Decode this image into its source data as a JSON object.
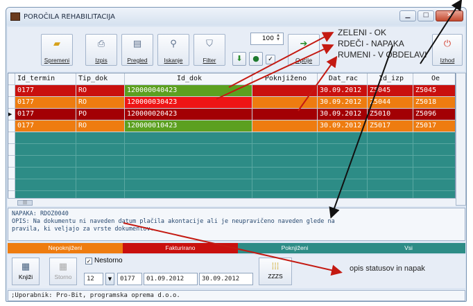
{
  "window": {
    "title": "POROČILA REHABILITACIJA",
    "min_label": "▁",
    "max_label": "□",
    "close_label": "✕"
  },
  "toolbar": {
    "buttons": [
      {
        "label": "Spremeni",
        "icon": "folder-icon"
      },
      {
        "label": "Izpis",
        "icon": "printer-icon"
      },
      {
        "label": "Pregled",
        "icon": "document-icon"
      },
      {
        "label": "Iskanje",
        "icon": "search-icon"
      },
      {
        "label": "Filter",
        "icon": "filter-icon"
      }
    ],
    "counter_value": "100",
    "opcije_label": "Opcije",
    "izhod_label": "Izhod"
  },
  "legend_lines": [
    "ZELENI - OK",
    "RDEČI - NAPAKA",
    "RUMENI - V OBDELAVI"
  ],
  "grid": {
    "columns": [
      "Id_termin",
      "Tip_dok",
      "Id_dok",
      "Poknjiženo",
      "Dat_rac",
      "Id_izp",
      "Oe"
    ],
    "rows": [
      {
        "cells": [
          "0177",
          "RO",
          "120000040423",
          "",
          "30.09.2012",
          "Z5045",
          "Z5045"
        ],
        "color": "red",
        "dok_color": "green",
        "selected": false
      },
      {
        "cells": [
          "0177",
          "RO",
          "120000030423",
          "",
          "30.09.2012",
          "Z5044",
          "Z5018"
        ],
        "color": "orange",
        "dok_color": "bright",
        "selected": false
      },
      {
        "cells": [
          "0177",
          "PO",
          "120000020423",
          "",
          "30.09.2012",
          "Z5010",
          "Z5096"
        ],
        "color": "dred",
        "dok_color": "dred",
        "selected": true
      },
      {
        "cells": [
          "0177",
          "RO",
          "120000010423",
          "",
          "30.09.2012",
          "Z5017",
          "Z5017"
        ],
        "color": "orange",
        "dok_color": "green",
        "selected": false
      }
    ],
    "empty_rows": 9
  },
  "message": {
    "line1": "NAPAKA: RDOZ0040",
    "line2": "OPIS: Na dokumentu ni naveden datum plačila akontacije ali je neupravičeno naveden glede na",
    "line3": "pravila, ki veljajo za vrste dokumentov."
  },
  "tabs": [
    {
      "label": "Nepoknjiženi",
      "color": "#ee7c10"
    },
    {
      "label": "Fakturirano",
      "color": "#c9100e"
    },
    {
      "label": "Poknjiženi",
      "color": "#2d8c86"
    },
    {
      "label": "Vsi",
      "color": "#2d8c86"
    }
  ],
  "bottom": {
    "knjizi_label": "Knjiži",
    "storno_label": "Storno",
    "nestorno_label": "Nestorno",
    "month": "12",
    "termin": "0177",
    "date_from": "01.09.2012",
    "date_to": "30.09.2012",
    "zzzs_label": "ZZZS"
  },
  "annotation_note": "opis statusov in napak",
  "statusbar": ";Uporabnik: Pro-Bit, programska oprema d.o.o.",
  "colors": {
    "red": "#c9100e",
    "orange": "#ee7c10",
    "green": "#5ca020",
    "teal": "#2d8c86"
  }
}
